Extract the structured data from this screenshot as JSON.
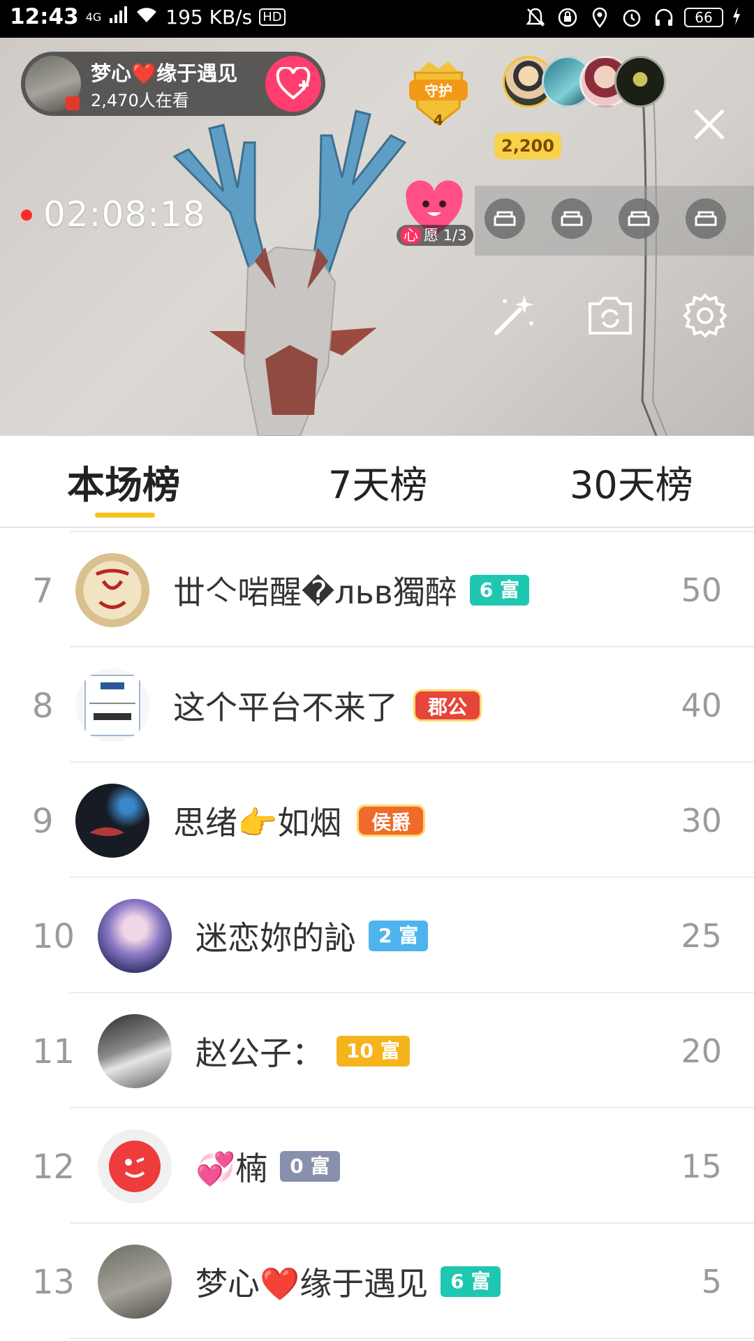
{
  "status_bar": {
    "time": "12:43",
    "network": "4G",
    "speed": "195 KB/s",
    "hd": "HD",
    "battery": "66"
  },
  "live": {
    "host_name": "梦心❤️缘于遇见",
    "viewer_count": "2,470人在看",
    "guard_label": "守护",
    "guard_count": "4",
    "coins": "2,200",
    "timer": "02:08:18",
    "wish_label_mark": "心",
    "wish_label": "愿 1/3"
  },
  "tabs": [
    {
      "label": "本场榜",
      "active": true
    },
    {
      "label": "7天榜",
      "active": false
    },
    {
      "label": "30天榜",
      "active": false
    }
  ],
  "ranking": [
    {
      "rank": "7",
      "name": "丗亽啱醒�льв獨醉",
      "badge": "6 富",
      "badge_color": "#1ec8b0",
      "score": "50"
    },
    {
      "rank": "8",
      "name": "这个平台不来了",
      "badge": "郡公",
      "badge_color": "#e6453a",
      "score": "40"
    },
    {
      "rank": "9",
      "name": "思绪👉如烟",
      "badge": "侯爵",
      "badge_color": "#f06a2a",
      "score": "30"
    },
    {
      "rank": "10",
      "name": "迷恋妳的訫",
      "badge": "2 富",
      "badge_color": "#4fb4ee",
      "score": "25"
    },
    {
      "rank": "11",
      "name": "赵公子：",
      "badge": "10 富",
      "badge_color": "#f6b41c",
      "score": "20"
    },
    {
      "rank": "12",
      "name": "💞楠",
      "badge": "0 富",
      "badge_color": "#8791ad",
      "score": "15"
    },
    {
      "rank": "13",
      "name": "梦心❤️缘于遇见",
      "badge": "6 富",
      "badge_color": "#1ec8b0",
      "score": "5"
    }
  ],
  "colors": {
    "accent_yellow": "#f7c21a",
    "follow_pink": "#ff3d6e",
    "rank_gray": "#9b9b9b"
  }
}
